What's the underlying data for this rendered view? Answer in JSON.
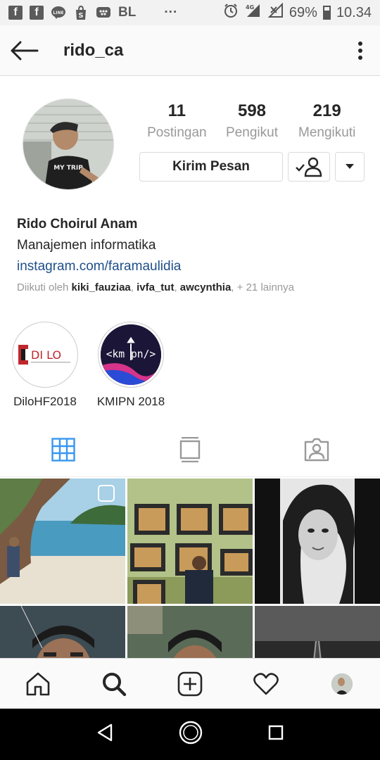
{
  "status_bar": {
    "icons_left": [
      "facebook-icon",
      "facebook-icon",
      "line-icon",
      "shopee-icon",
      "bbm-icon"
    ],
    "carrier_text": "BL",
    "more": "···",
    "network": "4G",
    "battery": "69%",
    "time": "10.34"
  },
  "header": {
    "username": "rido_ca"
  },
  "profile": {
    "stats": [
      {
        "value": "11",
        "label": "Postingan"
      },
      {
        "value": "598",
        "label": "Pengikut"
      },
      {
        "value": "219",
        "label": "Mengikuti"
      }
    ],
    "message_button": "Kirim Pesan",
    "name": "Rido Choirul Anam",
    "bio": "Manajemen informatika",
    "link": "instagram.com/faramaulidia",
    "followed_prefix": "Diikuti oleh ",
    "followed_users": [
      "kiki_fauziaa",
      "ivfa_tut",
      "awcynthia"
    ],
    "followed_sep": ", ",
    "followed_suffix": ", + 21 lainnya"
  },
  "highlights": [
    {
      "label": "DiloHF2018",
      "logo_text": "DI LO"
    },
    {
      "label": "KMIPN 2018",
      "logo_text": "<km pn/>"
    }
  ],
  "tabs": [
    "grid-tab",
    "feed-tab",
    "tagged-tab"
  ],
  "colors": {
    "link": "#1e4f8a",
    "active_tab": "#3897f0",
    "muted": "#999999"
  }
}
